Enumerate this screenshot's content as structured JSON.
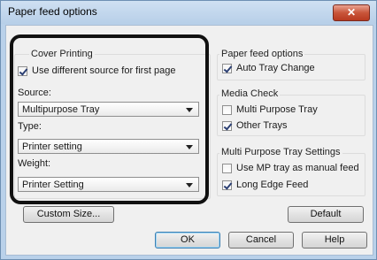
{
  "window": {
    "title": "Paper feed options",
    "close_glyph": "✕"
  },
  "cover_printing": {
    "title": "Cover Printing",
    "use_different_source": {
      "label": "Use different source for first page",
      "checked": true
    },
    "source": {
      "label": "Source:",
      "value": "Multipurpose Tray"
    },
    "type": {
      "label": "Type:",
      "value": "Printer setting"
    },
    "weight": {
      "label": "Weight:",
      "value": "Printer Setting"
    }
  },
  "paper_feed_options": {
    "title": "Paper feed options",
    "auto_tray_change": {
      "label": "Auto Tray Change",
      "checked": true
    }
  },
  "media_check": {
    "title": "Media Check",
    "multi_purpose_tray": {
      "label": "Multi Purpose Tray",
      "checked": false
    },
    "other_trays": {
      "label": "Other Trays",
      "checked": true
    }
  },
  "mp_tray_settings": {
    "title": "Multi Purpose Tray Settings",
    "use_mp_tray_manual": {
      "label": "Use MP tray as manual feed",
      "checked": false
    },
    "long_edge_feed": {
      "label": "Long Edge Feed",
      "checked": true
    }
  },
  "buttons": {
    "custom_size": "Custom Size...",
    "default": "Default",
    "ok": "OK",
    "cancel": "Cancel",
    "help": "Help"
  }
}
